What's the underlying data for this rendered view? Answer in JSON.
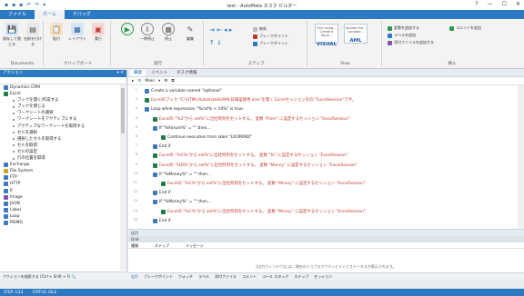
{
  "window": {
    "title": "test - AutoMate タスク ビルダー",
    "quick_access": [
      "▪",
      "▪",
      "▪",
      "↶",
      "↷",
      "▾"
    ],
    "controls": [
      "?",
      "—",
      "☐",
      "✕"
    ]
  },
  "ribbon_tabs": [
    "ファイル",
    "ホーム",
    "デバッグ"
  ],
  "ribbon": {
    "documents": {
      "label": "Documents",
      "buttons": [
        "保存して閉じる",
        "名前を付ける"
      ]
    },
    "clipboard": {
      "label": "クリップボード",
      "buttons": [
        "貼付",
        "レイアウト",
        "実行"
      ]
    },
    "run": {
      "label": "実行",
      "buttons": [
        "一時停止",
        "停止",
        "編集"
      ]
    },
    "steps": {
      "label": "ステップ",
      "items": [
        "無効",
        "ブレークポイント",
        "ブレークポイント"
      ]
    },
    "view": {
      "label": "View",
      "boxes": [
        {
          "top": "Run Using... Create a Varia...",
          "main": "VISUAL"
        },
        {
          "top": "Update the... variable...",
          "main": "AML"
        }
      ]
    },
    "insert": {
      "label": "挿入",
      "items": [
        "変数を追加する",
        "ラベルを追加",
        "添付ファイルを追加する",
        "コメントを追加"
      ]
    }
  },
  "left_panel": {
    "title": "アクション",
    "pin": "▾ ✕",
    "search": "",
    "items": [
      {
        "text": "Dynamics CRM",
        "level": 1,
        "color": "#3c7abf"
      },
      {
        "text": "Excel",
        "level": 1,
        "color": "#1e7e45"
      },
      {
        "text": "ブックを開く/作成する",
        "level": 2
      },
      {
        "text": "ブックを閉じる",
        "level": 2
      },
      {
        "text": "ワークシートの選択",
        "level": 2
      },
      {
        "text": "ワークシートをアクティブにする",
        "level": 2
      },
      {
        "text": "アクティブなワークシートを取得する",
        "level": 2
      },
      {
        "text": "セルを選択",
        "level": 2
      },
      {
        "text": "選択したセルを取得する",
        "level": 2
      },
      {
        "text": "セルを取得",
        "level": 2
      },
      {
        "text": "セルの設定",
        "level": 2
      },
      {
        "text": "行の位置を取得",
        "level": 2
      },
      {
        "text": "Exchange",
        "level": 1,
        "color": "#3c7abf"
      },
      {
        "text": "File System",
        "level": 1,
        "color": "#d7a21f"
      },
      {
        "text": "FTP",
        "level": 1,
        "color": "#3c7abf"
      },
      {
        "text": "HTTP",
        "level": 1,
        "color": "#3c7abf"
      },
      {
        "text": "If",
        "level": 1,
        "color": "#3c7abf"
      },
      {
        "text": "Image",
        "level": 1,
        "color": "#7d58a8"
      },
      {
        "text": "JSON",
        "level": 1,
        "color": "#3c7abf"
      },
      {
        "text": "Label",
        "level": 1,
        "color": "#3c7abf"
      },
      {
        "text": "Loop",
        "level": 1,
        "color": "#3c7abf"
      },
      {
        "text": "MSMQ",
        "level": 1,
        "color": "#3c7abf"
      }
    ],
    "footer": "アクションを検索する (Ctrl + Shift + F)   🔍"
  },
  "editor": {
    "tabs": [
      "職能",
      "イベント",
      "タスク情報"
    ],
    "toolbar": {
      "step": "Main",
      "icons": [
        "▸",
        "▾",
        "⚙",
        "⧉"
      ]
    },
    "lines": [
      {
        "n": "1",
        "indent": 0,
        "icon": "#3c7abf",
        "text": "Create a variable named \"optional\""
      },
      {
        "n": "2",
        "indent": 0,
        "icon": "#1e7e45",
        "text": "Excelのブック \"C:\\HTML\\AutomateS\\AML日報差替用.xlsx\"を開く ExcelセッションをID \"ExcelSession\"です。",
        "red": true
      },
      {
        "n": "3",
        "indent": 0,
        "icon": "#3c7abf",
        "text": "Loop while expression \"%cnt% < 10%\" is true."
      },
      {
        "n": "4",
        "indent": 1,
        "icon": "#1e7e45",
        "text": "Excelの \"%2\"から set%\"に出社時刻をセットする。 変数 \"From\" に設定するセッション \"ExcelSession\"",
        "red": true
      },
      {
        "n": "5",
        "indent": 1,
        "icon": "#3c7abf",
        "text": "If \"%Forum%\" = \"\" then..."
      },
      {
        "n": "6",
        "indent": 2,
        "icon": "#1e7e45",
        "text": "Continue execution from label \"LOOPEND\""
      },
      {
        "n": "7",
        "indent": 1,
        "icon": "#3c7abf",
        "text": "End if"
      },
      {
        "n": "8",
        "indent": 1,
        "icon": "#1e7e45",
        "text": "Excelの \"%C%\"から set%\"に出社時刻をセットする。 変数 \"To\" に設定するセッション \"ExcelSession\"",
        "red": true
      },
      {
        "n": "9",
        "indent": 1,
        "icon": "#1e7e45",
        "text": "Excelの \"%D%\"から set%\"に出社時刻をセットする。 変数 \"Money\" に設定するセッション \"ExcelSession\"",
        "red": true
      },
      {
        "n": "10",
        "indent": 1,
        "icon": "#3c7abf",
        "text": "If \"%Money%\" = \"\" then..."
      },
      {
        "n": "11",
        "indent": 2,
        "icon": "#1e7e45",
        "text": "Excelの \"%C%\"から set%\"に出社時刻をセットする。 変数 \"Money\" に設定するセッション \"ExcelSession\"",
        "red": true
      },
      {
        "n": "12",
        "indent": 1,
        "icon": "#3c7abf",
        "text": "End if"
      },
      {
        "n": "13",
        "indent": 1,
        "icon": "#3c7abf",
        "text": "If \"%Money%\" = \"\" then..."
      },
      {
        "n": "14",
        "indent": 2,
        "icon": "#1e7e45",
        "text": "Excelの \"%C%\"から set%\"に出社時刻をセットする。 変数 \"Money\" に設定するセッション \"ExcelSession\"",
        "red": true
      },
      {
        "n": "15",
        "indent": 1,
        "icon": "#3c7abf",
        "text": "End if"
      }
    ]
  },
  "output": {
    "title": "出力",
    "subtitle": "Grid",
    "cols": [
      "種類",
      "ステップ",
      "メッセージ"
    ],
    "message": "[出力ウィンドウ]には、現在のジョブのアクティビティとステータスが表示されます。",
    "tabs": [
      "出力",
      "ブレークポイント",
      "ウォッチ",
      "ラベル",
      "添付ファイル",
      "コメント",
      "コール スタック",
      "ステップ",
      "セッション"
    ]
  },
  "statusbar": [
    "STEP: 1/14",
    "STATUS: IDLE"
  ]
}
